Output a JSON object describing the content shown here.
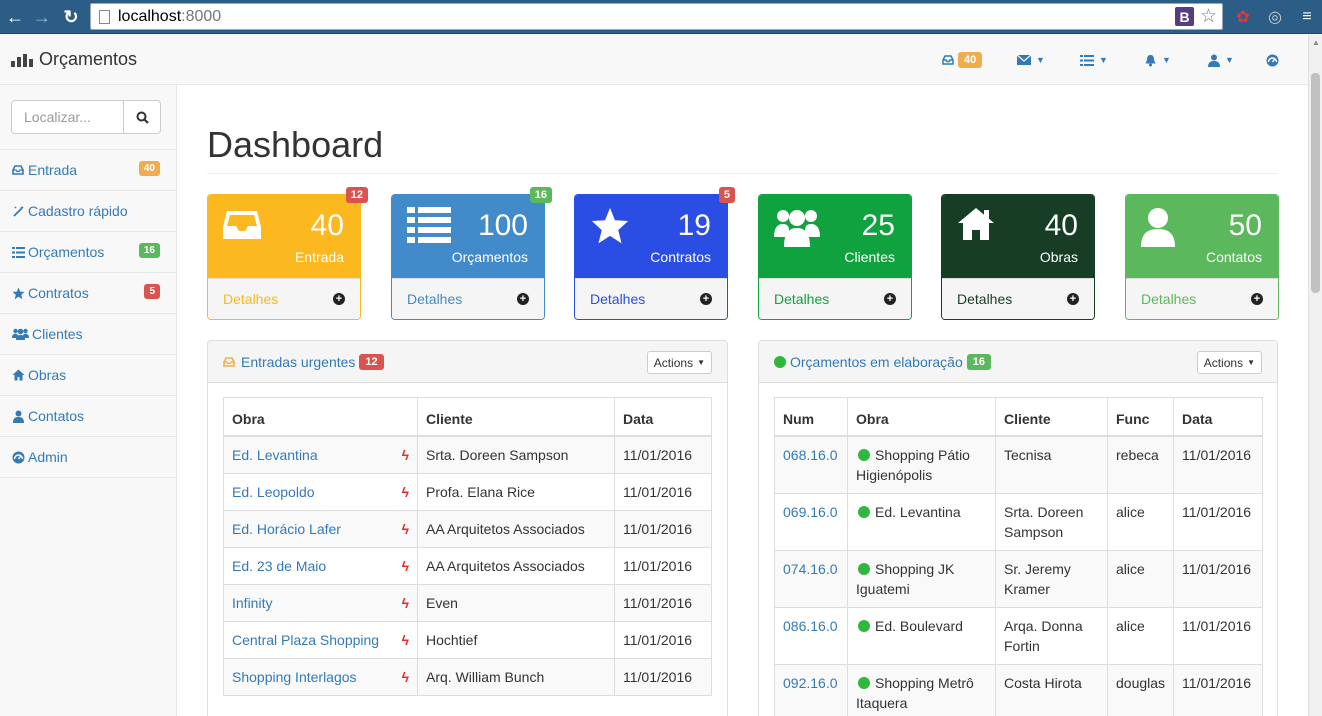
{
  "browser": {
    "url_host": "localhost",
    "url_port": ":8000",
    "bookmark_letter": "B"
  },
  "navbar": {
    "brand": "Orçamentos",
    "inbox_count": "40"
  },
  "sidebar": {
    "search_placeholder": "Localizar...",
    "items": [
      {
        "label": "Entrada",
        "badge": "40",
        "badge_color": "#f0ad4e"
      },
      {
        "label": "Cadastro rápido"
      },
      {
        "label": "Orçamentos",
        "badge": "16",
        "badge_color": "#5cb85c"
      },
      {
        "label": "Contratos",
        "badge": "5",
        "badge_color": "#d9534f"
      },
      {
        "label": "Clientes"
      },
      {
        "label": "Obras"
      },
      {
        "label": "Contatos"
      },
      {
        "label": "Admin"
      }
    ]
  },
  "page": {
    "title": "Dashboard"
  },
  "cards": [
    {
      "count": "40",
      "label": "Entrada",
      "details": "Detalhes",
      "badge": "12",
      "color": "#fbb91f",
      "icon": "inbox-icon"
    },
    {
      "count": "100",
      "label": "Orçamentos",
      "details": "Detalhes",
      "badge": "16",
      "color": "#428bca",
      "icon": "list-icon"
    },
    {
      "count": "19",
      "label": "Contratos",
      "details": "Detalhes",
      "badge": "5",
      "color": "#2a4ee4",
      "icon": "star-icon"
    },
    {
      "count": "25",
      "label": "Clientes",
      "details": "Detalhes",
      "color": "#0fa23e",
      "icon": "users-icon"
    },
    {
      "count": "40",
      "label": "Obras",
      "details": "Detalhes",
      "color": "#173d24",
      "icon": "home-icon"
    },
    {
      "count": "50",
      "label": "Contatos",
      "details": "Detalhes",
      "color": "#5cb85c",
      "icon": "user-icon"
    }
  ],
  "urgent_panel": {
    "title": "Entradas urgentes",
    "badge": "12",
    "actions": "Actions",
    "columns": [
      "Obra",
      "Cliente",
      "Data"
    ],
    "rows": [
      {
        "obra": "Ed. Levantina",
        "cliente": "Srta. Doreen Sampson",
        "data": "11/01/2016"
      },
      {
        "obra": "Ed. Leopoldo",
        "cliente": "Profa. Elana Rice",
        "data": "11/01/2016"
      },
      {
        "obra": "Ed. Horácio Lafer",
        "cliente": "AA Arquitetos Associados",
        "data": "11/01/2016"
      },
      {
        "obra": "Ed. 23 de Maio",
        "cliente": "AA Arquitetos Associados",
        "data": "11/01/2016"
      },
      {
        "obra": "Infinity",
        "cliente": "Even",
        "data": "11/01/2016"
      },
      {
        "obra": "Central Plaza Shopping",
        "cliente": "Hochtief",
        "data": "11/01/2016"
      },
      {
        "obra": "Shopping Interlagos",
        "cliente": "Arq. William Bunch",
        "data": "11/01/2016"
      }
    ]
  },
  "budget_panel": {
    "title": "Orçamentos em elaboração",
    "badge": "16",
    "actions": "Actions",
    "columns": [
      "Num",
      "Obra",
      "Cliente",
      "Func",
      "Data"
    ],
    "rows": [
      {
        "num": "068.16.0",
        "obra": "Shopping Pátio Higienópolis",
        "cliente": "Tecnisa",
        "func": "rebeca",
        "data": "11/01/2016"
      },
      {
        "num": "069.16.0",
        "obra": "Ed. Levantina",
        "cliente": "Srta. Doreen Sampson",
        "func": "alice",
        "data": "11/01/2016"
      },
      {
        "num": "074.16.0",
        "obra": "Shopping JK Iguatemi",
        "cliente": "Sr. Jeremy Kramer",
        "func": "alice",
        "data": "11/01/2016"
      },
      {
        "num": "086.16.0",
        "obra": "Ed. Boulevard",
        "cliente": "Arqa. Donna Fortin",
        "func": "alice",
        "data": "11/01/2016"
      },
      {
        "num": "092.16.0",
        "obra": "Shopping Metrô Itaquera",
        "cliente": "Costa Hirota",
        "func": "douglas",
        "data": "11/01/2016"
      }
    ]
  }
}
